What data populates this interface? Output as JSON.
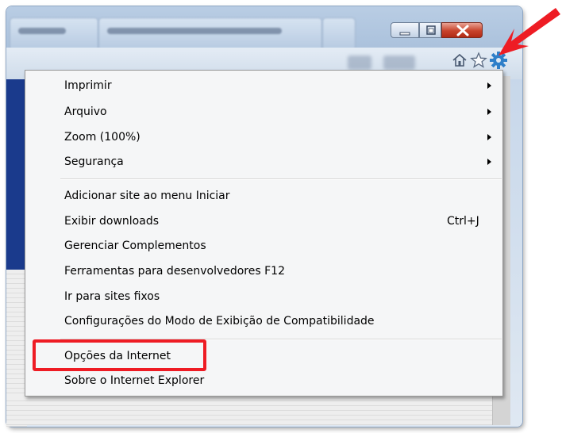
{
  "menu": {
    "items": [
      {
        "label": "Imprimir",
        "submenu": true
      },
      {
        "label": "Arquivo",
        "submenu": true
      },
      {
        "label": "Zoom (100%)",
        "submenu": true
      },
      {
        "label": "Segurança",
        "submenu": true
      },
      {
        "label": "Adicionar site ao menu Iniciar"
      },
      {
        "label": "Exibir downloads",
        "shortcut": "Ctrl+J"
      },
      {
        "label": "Gerenciar Complementos"
      },
      {
        "label": "Ferramentas para desenvolvedores F12"
      },
      {
        "label": "Ir para sites fixos"
      },
      {
        "label": "Configurações do Modo de Exibição de Compatibilidade"
      },
      {
        "label": "Opções da Internet",
        "highlighted": true
      },
      {
        "label": "Sobre o Internet Explorer"
      }
    ]
  },
  "toolbar": {
    "icons": [
      "home-icon",
      "favorites-star-icon",
      "tools-gear-icon"
    ]
  },
  "window_controls": [
    "minimize-icon",
    "maximize-icon",
    "close-icon"
  ],
  "colors": {
    "highlight_border": "#ee1c24",
    "arrow": "#ee1c24",
    "gear": "#2e7fc9",
    "close_button": "#c8432b"
  }
}
